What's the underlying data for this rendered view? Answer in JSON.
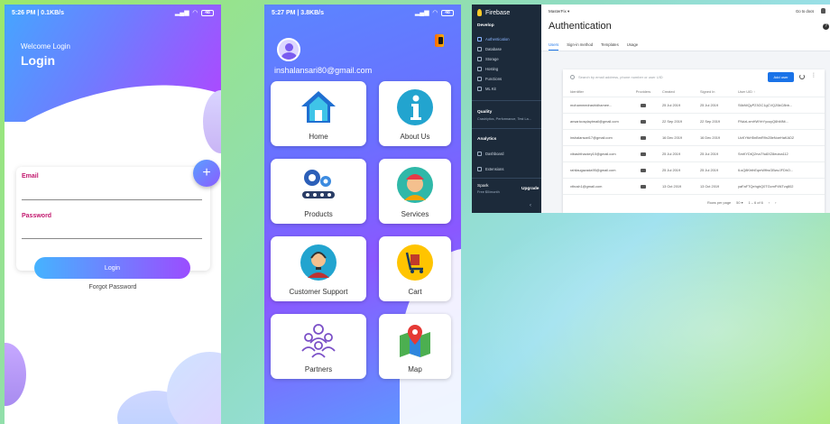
{
  "login": {
    "status": {
      "time": "5:26 PM | 0.1KB/s",
      "battery": "48"
    },
    "welcome": "Welcome Login",
    "title": "Login",
    "email_label": "Email",
    "password_label": "Password",
    "button": "Login",
    "forgot": "Forgot Password"
  },
  "home": {
    "status": {
      "time": "5:27 PM | 3.8KB/s",
      "battery": "48"
    },
    "user_email": "inshalansari80@gmail.com",
    "tiles": [
      {
        "label": "Home",
        "icon": "house-icon"
      },
      {
        "label": "About Us",
        "icon": "info-icon"
      },
      {
        "label": "Products",
        "icon": "gears-icon"
      },
      {
        "label": "Services",
        "icon": "worker-icon"
      },
      {
        "label": "Customer Support",
        "icon": "support-agent-icon"
      },
      {
        "label": "Cart",
        "icon": "cart-icon"
      },
      {
        "label": "Partners",
        "icon": "team-icon"
      },
      {
        "label": "Map",
        "icon": "map-pin-icon"
      }
    ]
  },
  "firebase": {
    "brand": "Firebase",
    "project": "MasterFix",
    "goto": "Go to docs",
    "title": "Authentication",
    "tabs": [
      "Users",
      "Sign-in method",
      "Templates",
      "Usage"
    ],
    "sidebar": {
      "develop": "Develop",
      "develop_items": [
        "Authentication",
        "Database",
        "Storage",
        "Hosting",
        "Functions",
        "ML Kit"
      ],
      "quality": "Quality",
      "quality_sub": "Crashlytics, Performance, Test La...",
      "analytics": "Analytics",
      "analytics_items": [
        "Dashboard",
        "Extensions"
      ],
      "plan": "Spark",
      "plan_sub": "Free $0/month",
      "upgrade": "Upgrade"
    },
    "search_placeholder": "Search by email address, phone number or user UID",
    "add_user": "Add user",
    "columns": [
      "Identifier",
      "Providers",
      "Created",
      "Signed In",
      "User UID ↑"
    ],
    "rows": [
      {
        "id": "mohammedrashidhamee...",
        "created": "25 Jul 2019",
        "signed": "25 Jul 2019",
        "uid": "S6kNIQyP23GC1gCVQZ6kC8bb..."
      },
      {
        "id": "ansaricosplaytmail@gmail.com",
        "created": "22 Sep 2019",
        "signed": "22 Sep 2019",
        "uid": "FNdzLxmHWYeYycuyQ6hMNt..."
      },
      {
        "id": "inshalansari17@gmail.com",
        "created": "16 Dec 2019",
        "signed": "16 Dec 2019",
        "uid": "UcKYtkH5nBmR9nZ8eNoeHaKAD2"
      },
      {
        "id": "vibashthackey10@gmail.com",
        "created": "25 Jul 2019",
        "signed": "25 Jul 2019",
        "uid": "SmKYDtQ2rvsTfu8XZ8eulxa112"
      },
      {
        "id": "rahilaugazada95@gmail.com",
        "created": "25 Jul 2019",
        "signed": "25 Jul 2019",
        "uid": "ILsQ8KhthEqmWfhsGBwvJFDhO..."
      },
      {
        "id": "vthush1@gmail.com",
        "created": "13 Oct 2019",
        "signed": "13 Oct 2019",
        "uid": "yaFaFTQehghQ0TGcmP4NTvq802"
      }
    ],
    "rows_per_page": "Rows per page",
    "rows_value": "50",
    "pagination": "1 – 6 of 6"
  }
}
